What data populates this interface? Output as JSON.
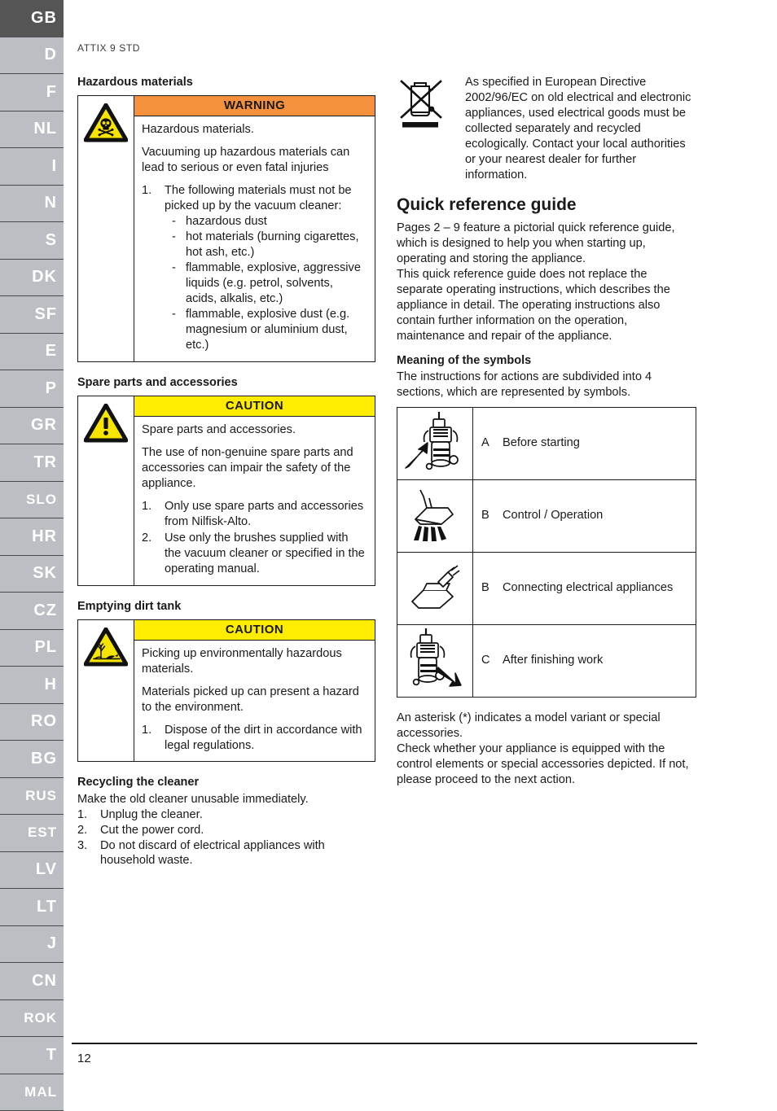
{
  "sidebar": {
    "active": "GB",
    "items": [
      {
        "label": "GB"
      },
      {
        "label": "D"
      },
      {
        "label": "F"
      },
      {
        "label": "NL"
      },
      {
        "label": "I"
      },
      {
        "label": "N"
      },
      {
        "label": "S"
      },
      {
        "label": "DK"
      },
      {
        "label": "SF"
      },
      {
        "label": "E"
      },
      {
        "label": "P"
      },
      {
        "label": "GR"
      },
      {
        "label": "TR"
      },
      {
        "label": "SLO"
      },
      {
        "label": "HR"
      },
      {
        "label": "SK"
      },
      {
        "label": "CZ"
      },
      {
        "label": "PL"
      },
      {
        "label": "H"
      },
      {
        "label": "RO"
      },
      {
        "label": "BG"
      },
      {
        "label": "RUS"
      },
      {
        "label": "EST"
      },
      {
        "label": "LV"
      },
      {
        "label": "LT"
      },
      {
        "label": "J"
      },
      {
        "label": "CN"
      },
      {
        "label": "ROK"
      },
      {
        "label": "T"
      },
      {
        "label": "MAL"
      }
    ]
  },
  "doc": {
    "running_head": "ATTIX 9 STD",
    "page_number": "12"
  },
  "left": {
    "hazardous": {
      "heading": "Hazardous materials",
      "alert_title": "WARNING",
      "icon": "skull-crossbones-hazard-icon",
      "p1": "Hazardous materials.",
      "p2": "Vacuuming up hazardous materials can lead to serious or even fatal injuries",
      "step1_marker": "1.",
      "step1": "The following materials must not be picked up by the vacuum cleaner:",
      "sub_items": [
        {
          "marker": "-",
          "text": "hazardous dust"
        },
        {
          "marker": "-",
          "text": "hot materials (burning cigarettes, hot ash, etc.)"
        },
        {
          "marker": "-",
          "text": "flammable, explosive, aggressive liquids (e.g. petrol, solvents, acids, alkalis, etc.)"
        },
        {
          "marker": "-",
          "text": "flammable, explosive dust (e.g. magnesium or aluminium dust, etc.)"
        }
      ]
    },
    "spare": {
      "heading": "Spare parts and accessories",
      "alert_title": "CAUTION",
      "icon": "exclamation-triangle-icon",
      "p1": "Spare parts and accessories.",
      "p2": "The use of non-genuine spare parts and accessories can impair the safety of the appliance.",
      "steps": [
        {
          "marker": "1.",
          "text": "Only use spare parts and accessories from Nilfisk-Alto."
        },
        {
          "marker": "2.",
          "text": "Use only the brushes supplied with the vacuum cleaner or specified in the operating manual."
        }
      ]
    },
    "emptying": {
      "heading": "Emptying dirt tank",
      "alert_title": "CAUTION",
      "icon": "environmental-hazard-icon",
      "p1": "Picking up environmentally hazardous materials.",
      "p2": "Materials picked up can present a hazard to the environment.",
      "steps": [
        {
          "marker": "1.",
          "text": "Dispose of the dirt in accordance with legal regulations."
        }
      ]
    },
    "recycling": {
      "heading": "Recycling the cleaner",
      "intro": "Make the old cleaner unusable immediately.",
      "steps": [
        {
          "marker": "1.",
          "text": "Unplug the cleaner."
        },
        {
          "marker": "2.",
          "text": "Cut the power cord."
        },
        {
          "marker": "3.",
          "text": "Do not discard of electrical appliances with household waste."
        }
      ]
    }
  },
  "right": {
    "weee": {
      "icon": "crossed-out-wheelie-bin-icon",
      "text": "As specified in European Directive 2002/96/EC on old electrical and electronic appliances, used electrical goods must be collected separately and recycled ecologically. Contact your local authorities or your nearest dealer for further information."
    },
    "quick_reference": {
      "heading": "Quick reference guide",
      "p1": "Pages 2 – 9 feature a pictorial quick reference guide, which is designed to help you when starting up, operating and storing the appliance.",
      "p2": "This quick reference guide does not replace the separate operating instructions, which describes the appliance in detail. The operating instructions also contain further information on the operation, maintenance and repair of the appliance."
    },
    "symbols": {
      "heading": "Meaning of the symbols",
      "intro": "The instructions for actions are subdivided into 4 sections, which are represented by symbols.",
      "rows": [
        {
          "icon": "vacuum-cleaner-arrow-in-icon",
          "letter": "A",
          "label": "Before starting"
        },
        {
          "icon": "floor-nozzle-icon",
          "letter": "B",
          "label": "Control / Operation"
        },
        {
          "icon": "power-tool-socket-icon",
          "letter": "B",
          "label": "Connecting electrical appliances"
        },
        {
          "icon": "vacuum-cleaner-arrow-out-icon",
          "letter": "C",
          "label": "After finishing work"
        }
      ]
    },
    "asterisk_note": {
      "p1": "An asterisk (*) indicates a model variant or special accessories.",
      "p2": "Check whether your appliance is equipped with the control elements or special accessories depicted. If not, please proceed to the next action."
    }
  },
  "colors": {
    "warning_orange": "#F5903C",
    "caution_yellow": "#FFED00",
    "sidebar_active": "#555555",
    "sidebar_inactive": "#BBBEC2"
  }
}
